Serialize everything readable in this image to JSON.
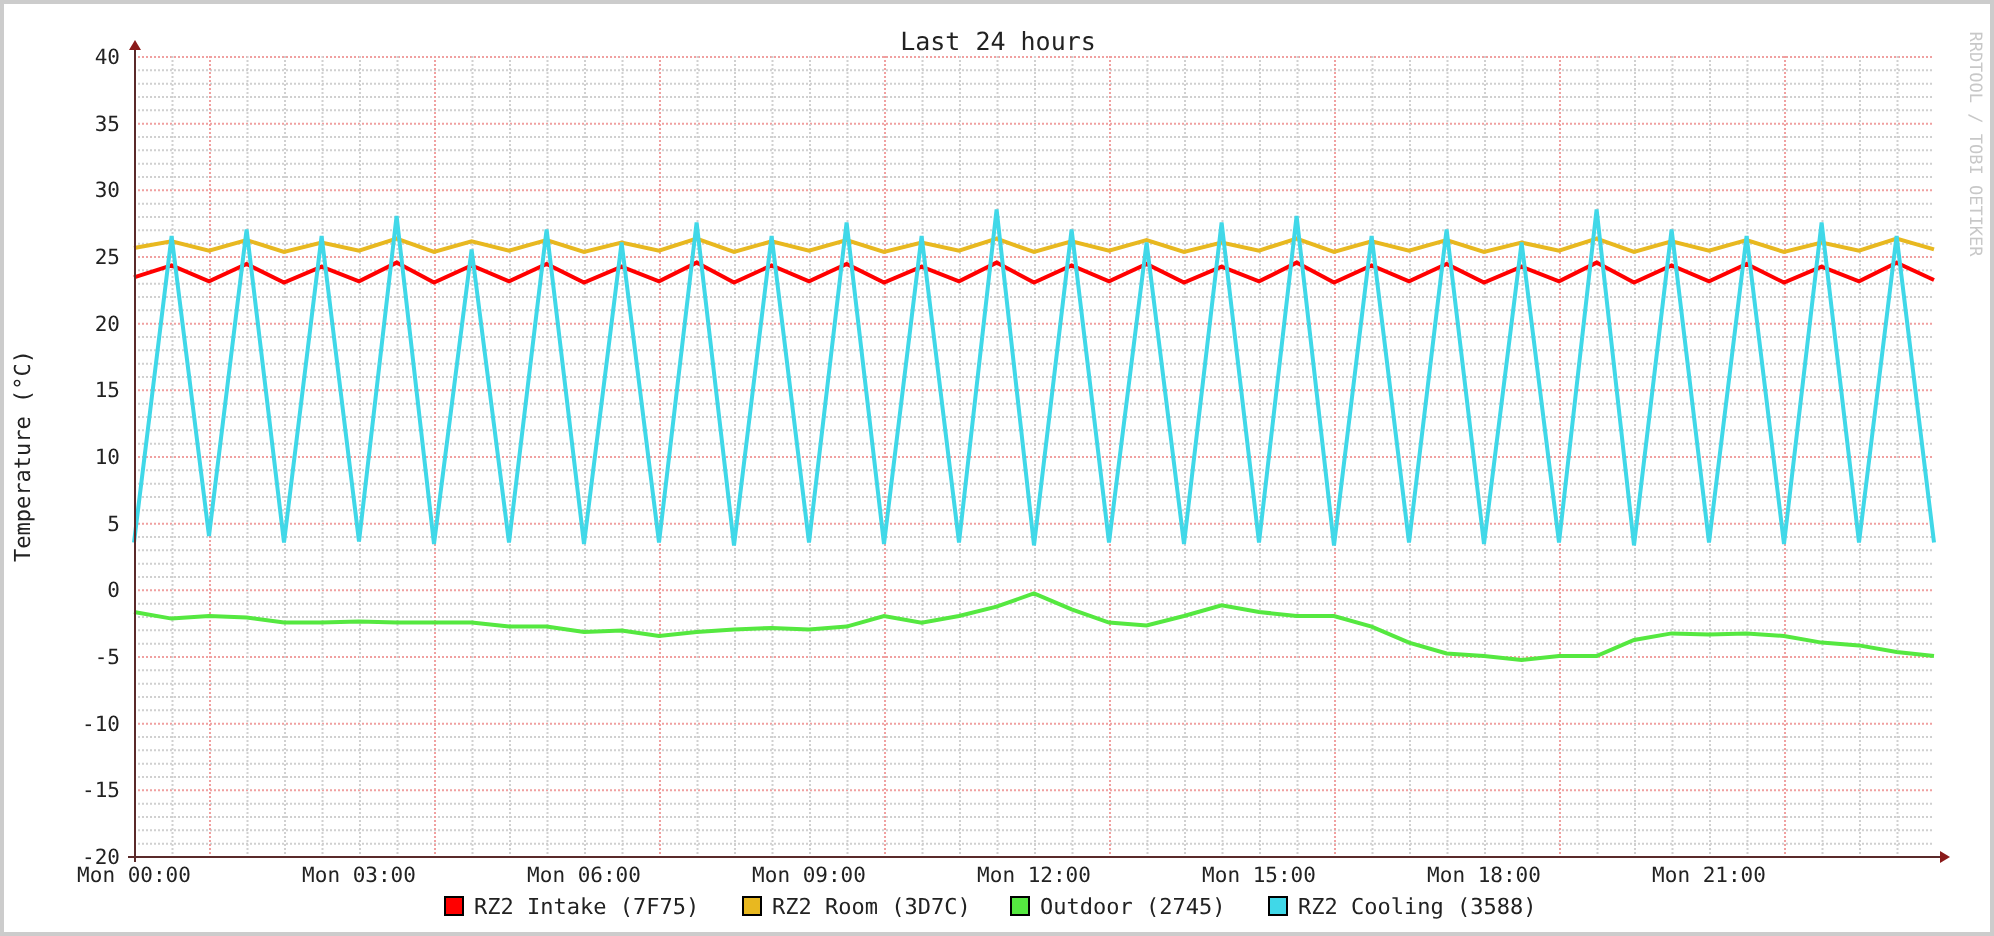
{
  "graph": {
    "side_label": "RRDTOOL / TOBI OETIKER",
    "chart_data": {
      "type": "line",
      "title": "Last 24 hours",
      "ylabel": "Temperature (°C)",
      "categories": [
        "Mon 00:00",
        null,
        null,
        null,
        null,
        null,
        "Mon 03:00",
        null,
        null,
        null,
        null,
        null,
        "Mon 06:00",
        null,
        null,
        null,
        null,
        null,
        "Mon 09:00",
        null,
        null,
        null,
        null,
        null,
        "Mon 12:00",
        null,
        null,
        null,
        null,
        null,
        "Mon 15:00",
        null,
        null,
        null,
        null,
        null,
        "Mon 18:00",
        null,
        null,
        null,
        null,
        null,
        "Mon 21:00",
        null,
        null,
        null,
        null,
        null,
        null
      ],
      "ylim": [
        -20,
        40
      ],
      "grid": true,
      "legend": "bottom",
      "yticks": [
        -20,
        -15,
        -10,
        -5,
        0,
        5,
        10,
        15,
        20,
        25,
        30,
        35,
        40
      ],
      "series": [
        {
          "name": "RZ2 Intake (7F75)",
          "color": "#ff0000",
          "values": [
            23.4,
            24.3,
            23.1,
            24.4,
            23.0,
            24.2,
            23.1,
            24.5,
            23.0,
            24.3,
            23.1,
            24.4,
            23.0,
            24.2,
            23.1,
            24.5,
            23.0,
            24.3,
            23.1,
            24.4,
            23.0,
            24.2,
            23.1,
            24.5,
            23.0,
            24.3,
            23.1,
            24.4,
            23.0,
            24.2,
            23.1,
            24.5,
            23.0,
            24.3,
            23.1,
            24.4,
            23.0,
            24.2,
            23.1,
            24.5,
            23.0,
            24.3,
            23.1,
            24.4,
            23.0,
            24.2,
            23.1,
            24.5,
            23.2
          ]
        },
        {
          "name": "RZ2 Room (3D7C)",
          "color": "#e8b820",
          "values": [
            25.6,
            26.1,
            25.4,
            26.2,
            25.3,
            26.0,
            25.4,
            26.3,
            25.3,
            26.1,
            25.4,
            26.2,
            25.3,
            26.0,
            25.4,
            26.3,
            25.3,
            26.1,
            25.4,
            26.2,
            25.3,
            26.0,
            25.4,
            26.3,
            25.3,
            26.1,
            25.4,
            26.2,
            25.3,
            26.0,
            25.4,
            26.3,
            25.3,
            26.1,
            25.4,
            26.2,
            25.3,
            26.0,
            25.4,
            26.3,
            25.3,
            26.1,
            25.4,
            26.2,
            25.3,
            26.0,
            25.4,
            26.3,
            25.5
          ]
        },
        {
          "name": "Outdoor (2745)",
          "color": "#55e840",
          "values": [
            -1.7,
            -2.2,
            -2.0,
            -2.1,
            -2.5,
            -2.5,
            -2.4,
            -2.5,
            -2.5,
            -2.5,
            -2.8,
            -2.8,
            -3.2,
            -3.1,
            -3.5,
            -3.2,
            -3.0,
            -2.9,
            -3.0,
            -2.8,
            -2.0,
            -2.5,
            -2.0,
            -1.3,
            -0.3,
            -1.5,
            -2.5,
            -2.7,
            -2.0,
            -1.2,
            -1.7,
            -2.0,
            -2.0,
            -2.8,
            -4.0,
            -4.8,
            -5.0,
            -5.3,
            -5.0,
            -5.0,
            -3.8,
            -3.3,
            -3.4,
            -3.3,
            -3.5,
            -4.0,
            -4.2,
            -4.7,
            -5.0
          ]
        },
        {
          "name": "RZ2 Cooling (3588)",
          "color": "#40d8e8",
          "values": [
            3.5,
            26.5,
            4.0,
            27.0,
            3.5,
            26.5,
            3.6,
            28.0,
            3.4,
            25.5,
            3.5,
            27.0,
            3.4,
            26.0,
            3.5,
            27.5,
            3.3,
            26.5,
            3.5,
            27.5,
            3.4,
            26.5,
            3.5,
            28.5,
            3.3,
            27.0,
            3.5,
            26.0,
            3.4,
            27.5,
            3.5,
            28.0,
            3.3,
            26.5,
            3.5,
            27.0,
            3.4,
            26.0,
            3.5,
            28.5,
            3.3,
            27.0,
            3.5,
            26.5,
            3.4,
            27.5,
            3.5,
            26.5,
            3.5
          ]
        }
      ]
    }
  }
}
